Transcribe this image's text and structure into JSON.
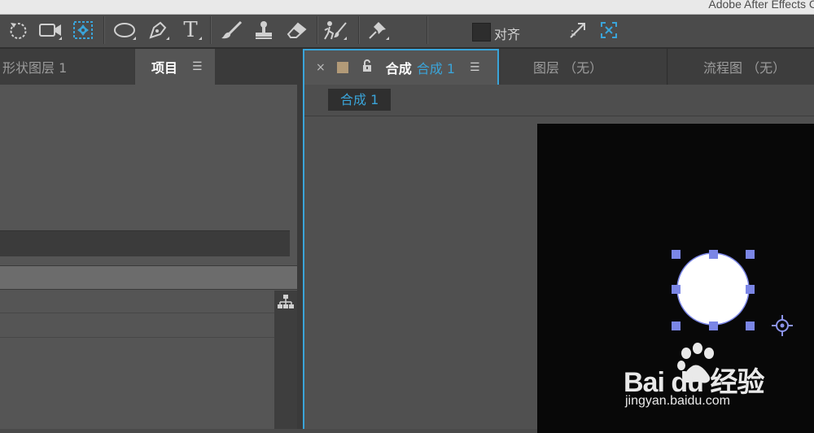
{
  "app": {
    "title": "Adobe After Effects C"
  },
  "toolbar": {
    "tools": [
      {
        "icon": "rotate-icon"
      },
      {
        "icon": "camera-icon"
      },
      {
        "icon": "pan-behind-icon",
        "active": true
      },
      {
        "icon": "ellipse-icon"
      },
      {
        "icon": "pen-icon"
      },
      {
        "icon": "type-icon",
        "glyph": "T"
      },
      {
        "icon": "brush-icon"
      },
      {
        "icon": "clone-stamp-icon"
      },
      {
        "icon": "eraser-icon"
      },
      {
        "icon": "roto-brush-icon"
      },
      {
        "icon": "puppet-pin-icon"
      }
    ],
    "align_label": "对齐"
  },
  "left_panel": {
    "tabs": [
      {
        "label": "形状图层 1"
      },
      {
        "label": "项目",
        "active": true,
        "menu": "☰"
      }
    ]
  },
  "comp_panel": {
    "tabs": [
      {
        "close": "×",
        "label": "合成",
        "name": "合成 1",
        "menu": "☰",
        "active": true
      },
      {
        "label": "图层 （无）"
      },
      {
        "label": "流程图 （无）"
      }
    ],
    "breadcrumb": "合成 1"
  },
  "watermark": {
    "brand": "Bai du 经验",
    "url": "jingyan.baidu.com"
  },
  "colors": {
    "accent": "#3aa4d9",
    "handle": "#7b86e6",
    "comp_swatch": "#b29a78",
    "canvas": "#080808"
  }
}
